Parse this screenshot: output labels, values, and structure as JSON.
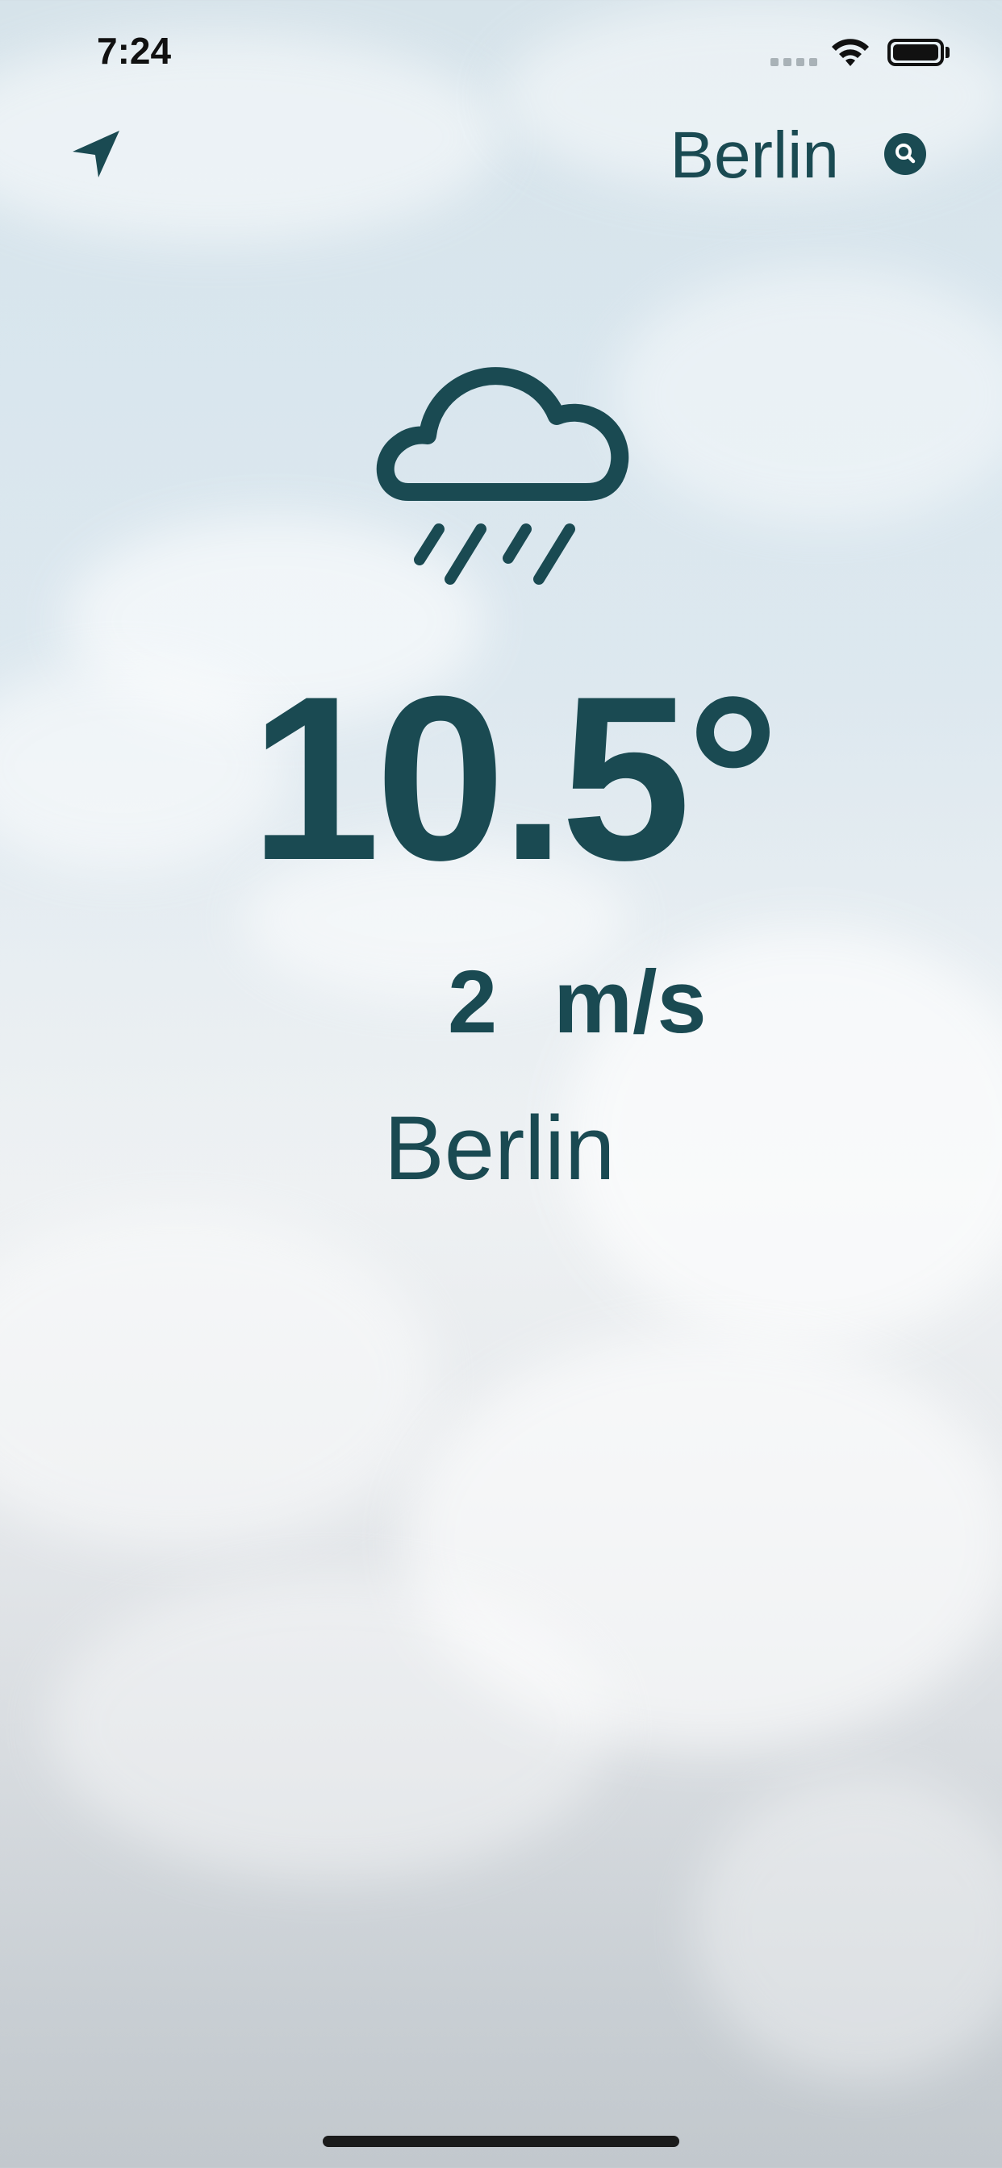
{
  "status_bar": {
    "time": "7:24"
  },
  "header": {
    "city": "Berlin",
    "location_icon": "location-arrow-icon",
    "search_icon": "search-icon"
  },
  "weather": {
    "icon": "cloud-rain-icon",
    "temperature": "10.5°",
    "wind_speed": "2",
    "wind_unit": "m/s",
    "city": "Berlin"
  },
  "colors": {
    "accent": "#1a4a52"
  }
}
